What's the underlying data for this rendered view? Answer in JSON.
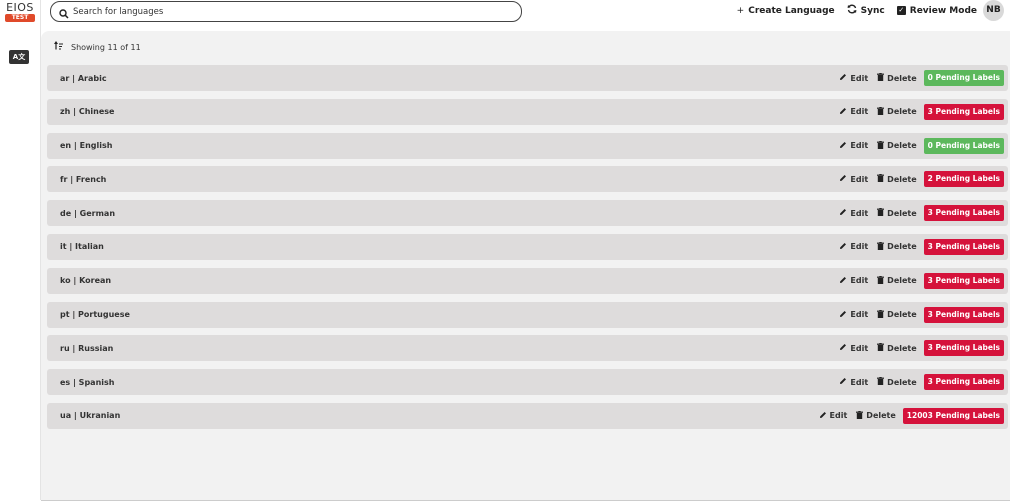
{
  "app": {
    "logo_text": "EIOS",
    "env_badge": "TEST",
    "sidebar_item_label": "A文"
  },
  "search": {
    "placeholder": "Search for languages"
  },
  "toolbar": {
    "create_label": "Create Language",
    "sync_label": "Sync",
    "review_label": "Review Mode",
    "review_checked": true,
    "avatar_initials": "NB"
  },
  "list": {
    "showing_text": "Showing 11 of 11",
    "edit_label": "Edit",
    "delete_label": "Delete",
    "colors": {
      "ok": "#5cb85c",
      "pending": "#d5123b"
    },
    "items": [
      {
        "label": "ar | Arabic",
        "badge": "0 Pending Labels",
        "status": "ok"
      },
      {
        "label": "zh | Chinese",
        "badge": "3 Pending Labels",
        "status": "pending"
      },
      {
        "label": "en | English",
        "badge": "0 Pending Labels",
        "status": "ok"
      },
      {
        "label": "fr | French",
        "badge": "2 Pending Labels",
        "status": "pending"
      },
      {
        "label": "de | German",
        "badge": "3 Pending Labels",
        "status": "pending"
      },
      {
        "label": "it | Italian",
        "badge": "3 Pending Labels",
        "status": "pending"
      },
      {
        "label": "ko | Korean",
        "badge": "3 Pending Labels",
        "status": "pending"
      },
      {
        "label": "pt | Portuguese",
        "badge": "3 Pending Labels",
        "status": "pending"
      },
      {
        "label": "ru | Russian",
        "badge": "3 Pending Labels",
        "status": "pending"
      },
      {
        "label": "es | Spanish",
        "badge": "3 Pending Labels",
        "status": "pending"
      },
      {
        "label": "ua | Ukranian",
        "badge": "12003 Pending Labels",
        "status": "pending"
      }
    ]
  }
}
